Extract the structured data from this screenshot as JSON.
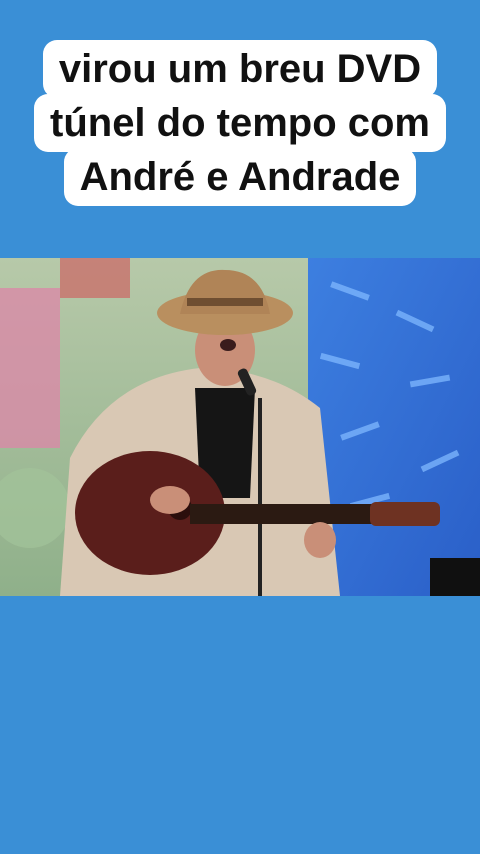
{
  "caption": {
    "lines": [
      "virou um breu DVD",
      "túnel do tempo com",
      "André e Andrade"
    ]
  },
  "video": {
    "description_icon": "musician-performing-image"
  },
  "colors": {
    "background": "#3a8fd6",
    "caption_bg": "#ffffff",
    "caption_text": "#111111"
  }
}
